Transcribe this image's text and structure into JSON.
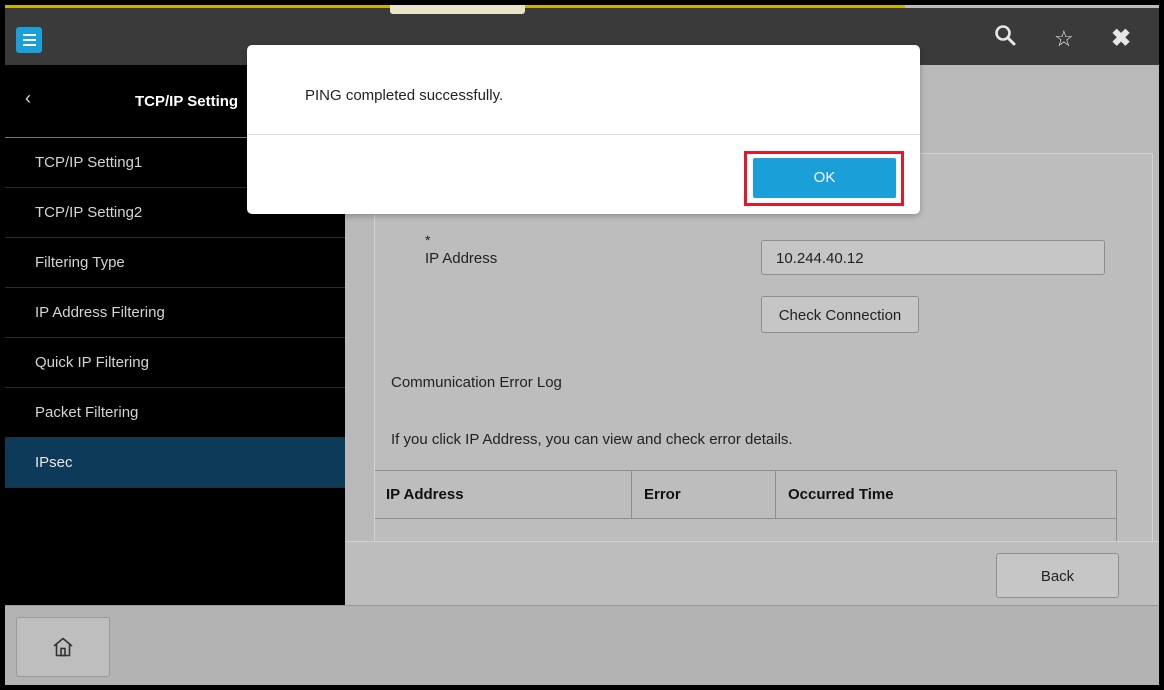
{
  "sidebar": {
    "title": "TCP/IP Setting",
    "items": [
      {
        "label": "TCP/IP Setting1"
      },
      {
        "label": "TCP/IP Setting2"
      },
      {
        "label": "Filtering Type"
      },
      {
        "label": "IP Address Filtering"
      },
      {
        "label": "Quick IP Filtering"
      },
      {
        "label": "Packet Filtering"
      },
      {
        "label": "IPsec",
        "active": true
      }
    ]
  },
  "form": {
    "required_mark": "*",
    "ip_label": "IP Address",
    "ip_value": "10.244.40.12",
    "check_button": "Check Connection"
  },
  "log": {
    "title": "Communication Error Log",
    "hint": "If you click IP Address, you can view and check error details.",
    "columns": [
      "IP Address",
      "Error",
      "Occurred Time"
    ]
  },
  "footer": {
    "back_label": "Back"
  },
  "dialog": {
    "message": "PING completed successfully.",
    "ok_label": "OK"
  },
  "colors": {
    "accent": "#1a9fd8",
    "highlight": "#e01a2a",
    "active_item": "#0e3a5a"
  },
  "icons": {
    "menu": "menu-icon",
    "search": "search-icon",
    "favorite": "star-icon",
    "close": "close-icon",
    "back": "chevron-left-icon",
    "home": "home-icon"
  }
}
